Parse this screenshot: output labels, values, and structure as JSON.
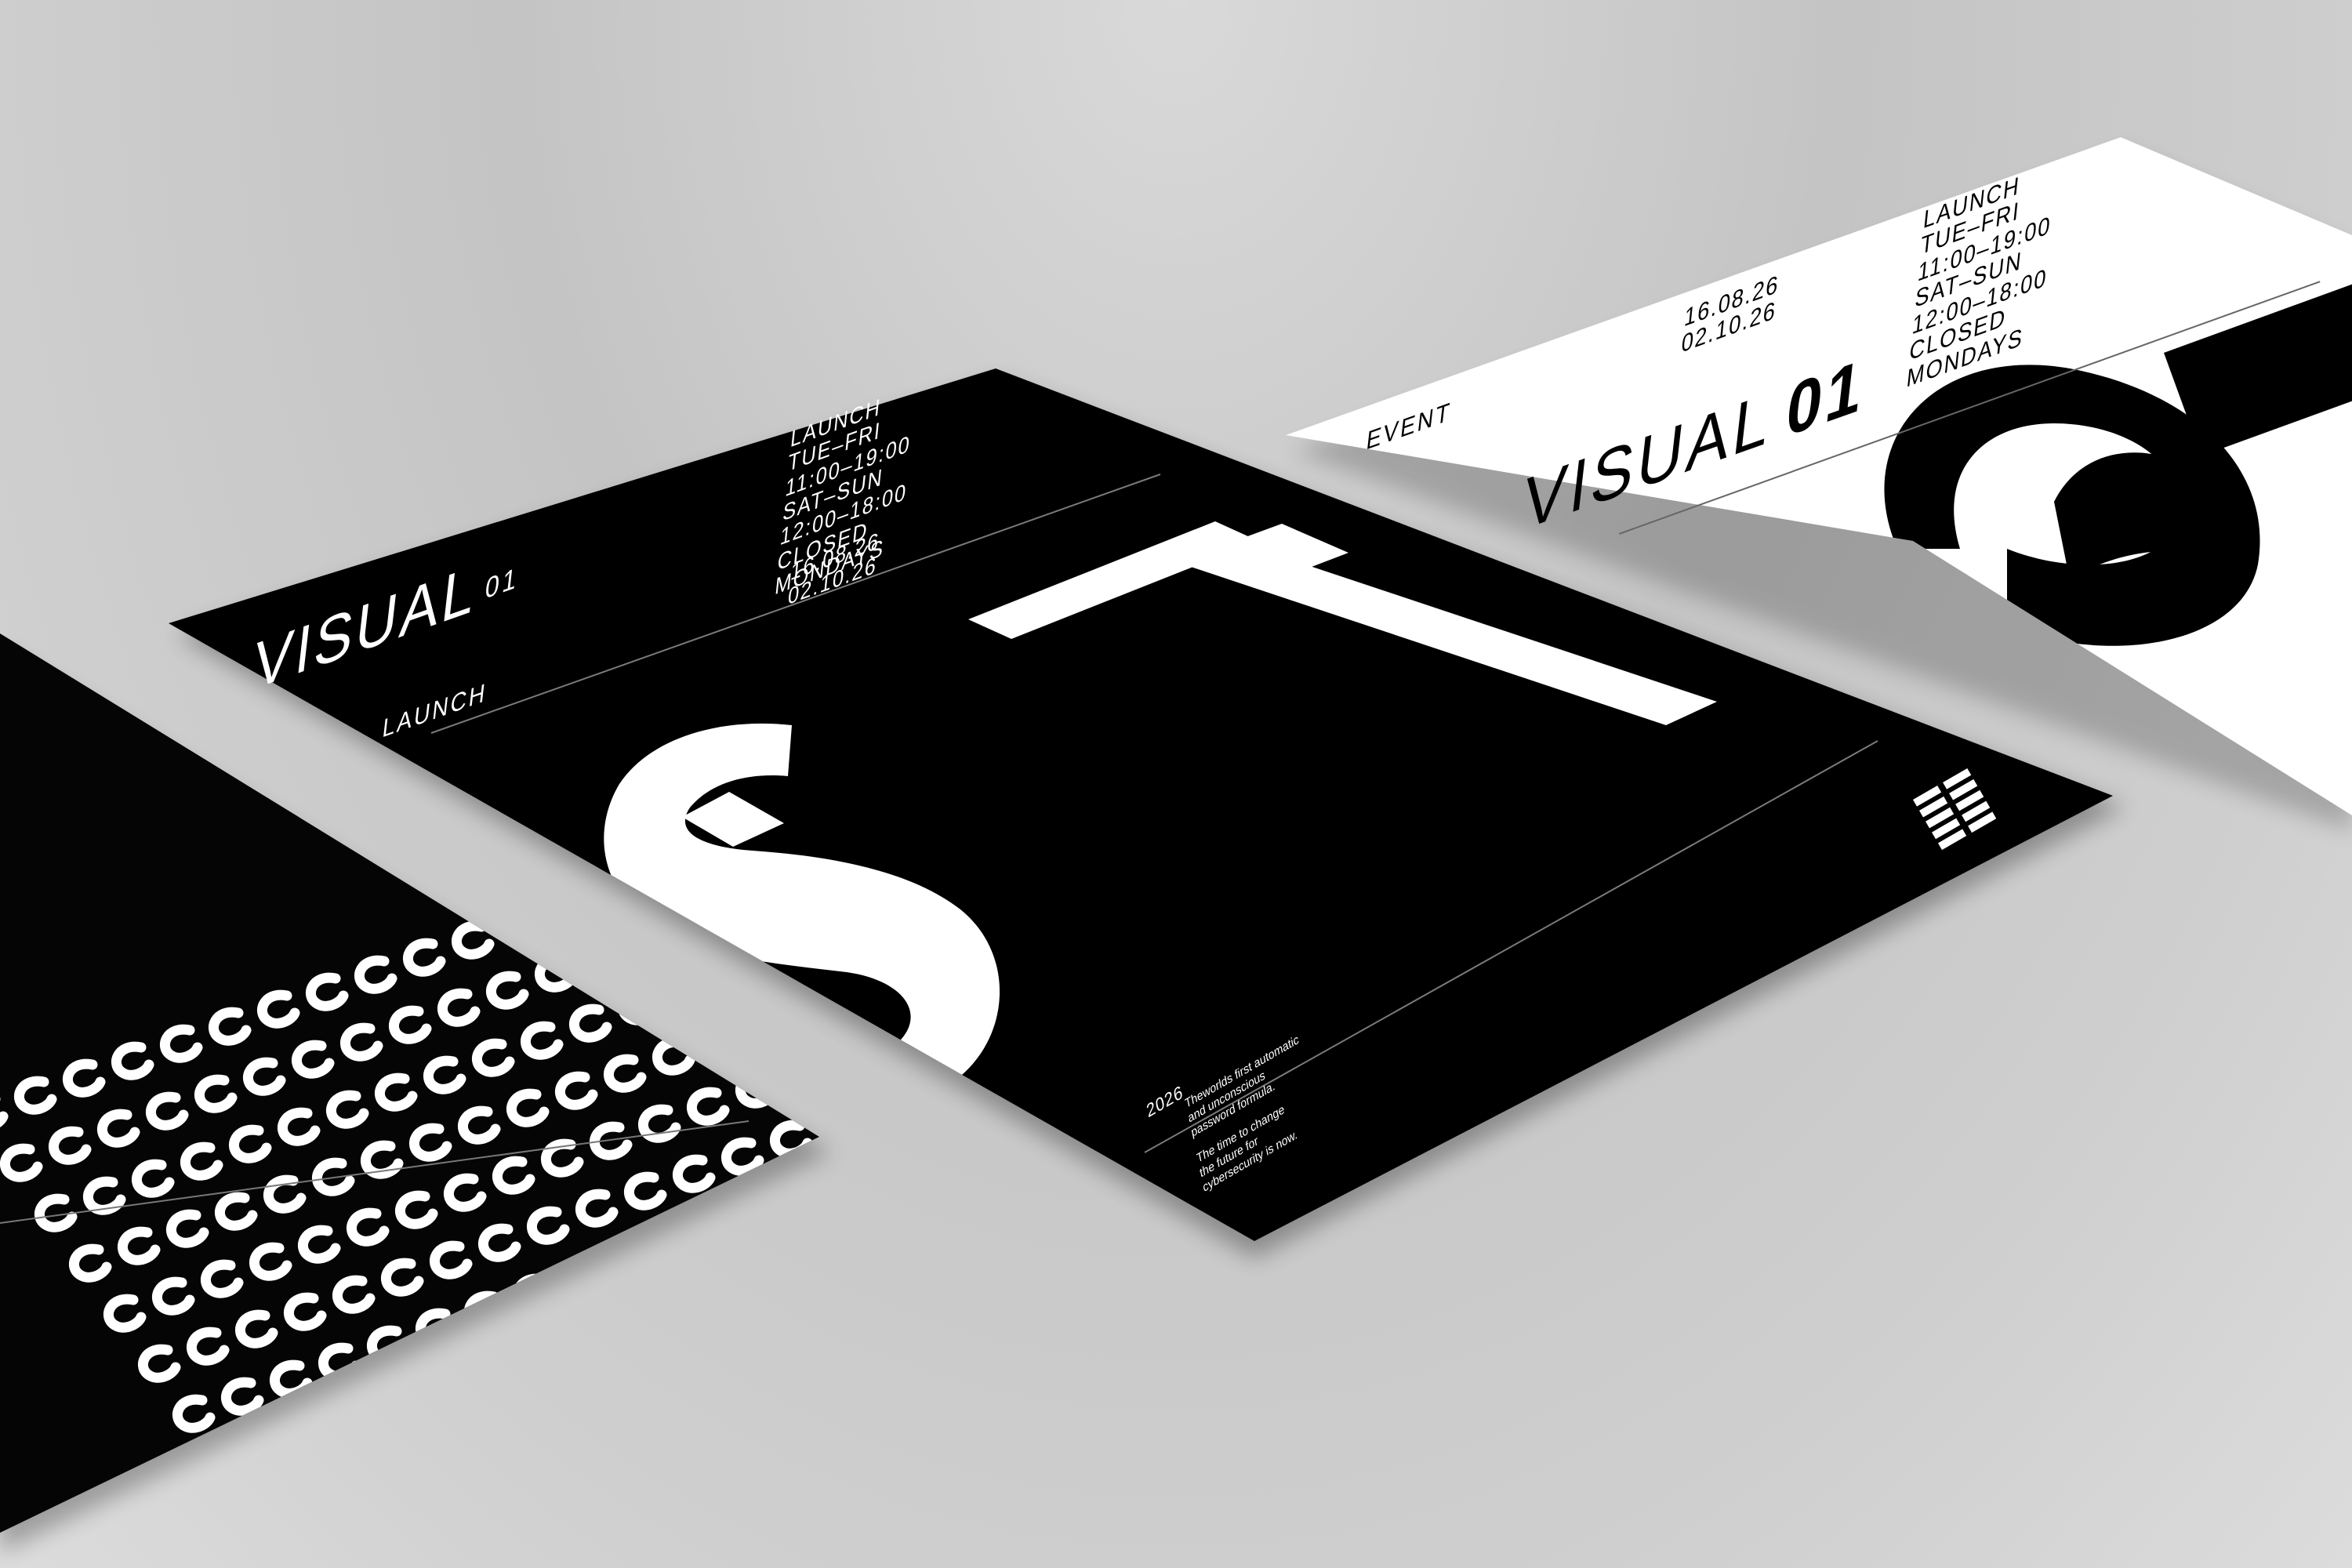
{
  "center_poster": {
    "title": "VISUAL",
    "title_suffix": "01",
    "tag": "LAUNCH",
    "hours": [
      "LAUNCH",
      "TUE–FRI",
      "11:00–19:00",
      "SAT–SUN",
      "12:00–18:00",
      "CLOSED",
      "MONDAYS"
    ],
    "dates": [
      "16.08.26",
      "02.10.26"
    ],
    "year": "2026",
    "body_1": [
      "Theworlds first automatic",
      "and unconscious",
      "password formula."
    ],
    "body_2": [
      "The time to change",
      "the future for",
      "cybersecurity is now."
    ],
    "glyphs": "ST"
  },
  "right_poster": {
    "tag": "EVENT",
    "title": "VISUAL",
    "title_suffix": "01",
    "hours": [
      "LAUNCH",
      "TUE–FRI",
      "11:00–19:00",
      "SAT–SUN",
      "12:00–18:00",
      "CLOSED",
      "MONDAYS"
    ],
    "dates": [
      "16.08.26",
      "02.10.26"
    ]
  },
  "left_poster": {
    "pattern_glyph": "C"
  },
  "colors": {
    "poster_dark": "#000000",
    "poster_light": "#ffffff",
    "backdrop": "#c8c8c8"
  }
}
